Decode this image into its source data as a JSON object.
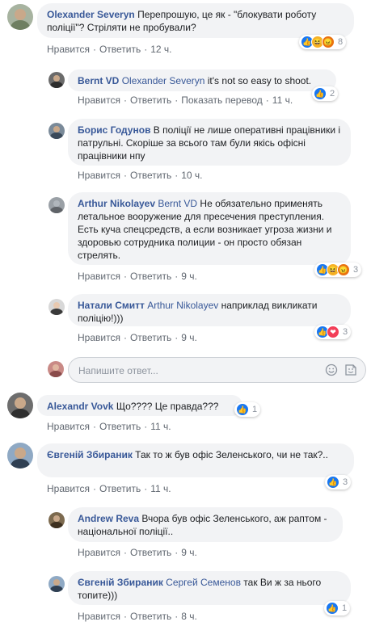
{
  "actions": {
    "like": "Нравится",
    "reply": "Ответить",
    "see_translation": "Показать перевод",
    "separator": "·"
  },
  "reply_box": {
    "placeholder": "Напишите ответ..."
  },
  "comments": [
    {
      "author": "Olexander Severyn",
      "text": "Перепрошую, це як - \"блокувати роботу поліції\"? Стріляти не пробували?",
      "time": "12 ч.",
      "reaction_icons": [
        "like",
        "haha",
        "angry"
      ],
      "reaction_count": "8"
    },
    {
      "author": "Bernt VD",
      "mention": "Olexander Severyn",
      "text": "it's not so easy to shoot.",
      "time": "11 ч.",
      "reaction_icons": [
        "like"
      ],
      "reaction_count": "2"
    },
    {
      "author": "Борис Годунов",
      "text": "В поліції не лише оперативні працівники і патрульні. Скоріше за всього там були якісь офісні працівники нпу",
      "time": "10 ч."
    },
    {
      "author": "Arthur Nikolayev",
      "mention": "Bernt VD",
      "text": "Не обязательно применять летальное вооружение для пресечения преступления. Есть куча спецсредств, а если возникает угроза жизни и здоровью сотрудника полиции - он просто обязан стрелять.",
      "time": "9 ч.",
      "reaction_icons": [
        "like",
        "haha",
        "angry"
      ],
      "reaction_count": "3"
    },
    {
      "author": "Натали Смитт",
      "mention": "Arthur Nikolayev",
      "text": "наприклад викликати поліцію!)))",
      "time": "9 ч.",
      "reaction_icons": [
        "like",
        "love"
      ],
      "reaction_count": "3"
    },
    {
      "author": "Alexandr Vovk",
      "text": "Що???? Це правда???",
      "time": "11 ч.",
      "reaction_icons": [
        "like"
      ],
      "reaction_count": "1"
    },
    {
      "author": "Євгеній Збираник",
      "text": "Так то ж був офіс Зеленського, чи не так?..",
      "time": "11 ч.",
      "reaction_icons": [
        "like"
      ],
      "reaction_count": "3"
    },
    {
      "author": "Andrew Reva",
      "text": "Вчора був офіс Зеленського, аж раптом - національної поліції..",
      "time": "9 ч."
    },
    {
      "author": "Євгеній Збираник",
      "mention": "Сергей Семенов",
      "text": "так Ви ж за нього топите)))",
      "time": "8 ч.",
      "reaction_icons": [
        "like"
      ],
      "reaction_count": "1"
    }
  ]
}
